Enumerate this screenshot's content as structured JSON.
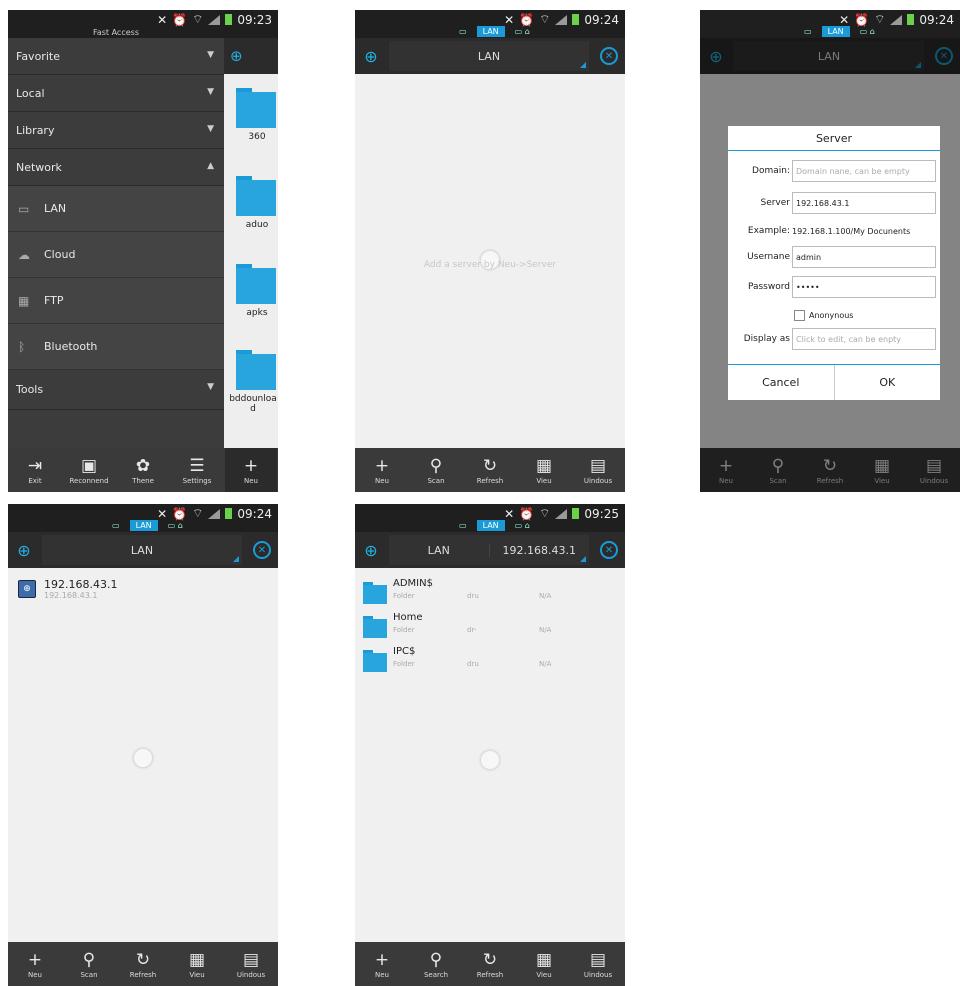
{
  "status": {
    "times": [
      "09:23",
      "09:24",
      "09:24",
      "09:24",
      "09:25"
    ]
  },
  "quick_tabs": {
    "lan": "LAN"
  },
  "drawer": {
    "fast_access": "Fast Access",
    "favorite": "Favorite",
    "local": "Local",
    "library": "Library",
    "network": "Network",
    "lan": "LAN",
    "cloud": "Cloud",
    "ftp": "FTP",
    "bluetooth": "Bluetooth",
    "tools": "Tools"
  },
  "behind_folders": [
    "360",
    "aduo",
    "apks",
    "bddounloa d"
  ],
  "bottom_bar_drawer": [
    {
      "icon": "exit-icon",
      "label": "Exit"
    },
    {
      "icon": "recommend-icon",
      "label": "Reconnend"
    },
    {
      "icon": "theme-icon",
      "label": "Thene"
    },
    {
      "icon": "settings-icon",
      "label": "Settings"
    },
    {
      "icon": "new-icon",
      "label": "Neu"
    }
  ],
  "bottom_bar": [
    {
      "icon": "new-icon",
      "label": "Neu"
    },
    {
      "icon": "scan-icon",
      "label": "Scan"
    },
    {
      "icon": "refresh-icon",
      "label": "Refresh"
    },
    {
      "icon": "view-icon",
      "label": "Vieu"
    },
    {
      "icon": "windows-icon",
      "label": "Uindous"
    }
  ],
  "bottom_bar_search": [
    {
      "icon": "new-icon",
      "label": "Neu"
    },
    {
      "icon": "search-icon",
      "label": "Search"
    },
    {
      "icon": "refresh-icon",
      "label": "Refresh"
    },
    {
      "icon": "view-icon",
      "label": "Vieu"
    },
    {
      "icon": "windows-icon",
      "label": "Uindous"
    }
  ],
  "path": {
    "lan": "LAN",
    "server": "192.168.43.1"
  },
  "empty_hint": "Add a server by Neu->Server",
  "dialog": {
    "title": "Server",
    "domain_label": "Domain:",
    "domain_placeholder": "Domain nane, can be empty",
    "server_label": "Server",
    "server_value": "192.168.43.1",
    "example_label": "Example:",
    "example_value": "192.168.1.100/My Docunents",
    "username_label": "Usernane",
    "username_value": "admin",
    "password_label": "Password",
    "password_value": "•••••",
    "anonymous_label": "Anonynous",
    "display_label": "Display as",
    "display_placeholder": "Click to edit, can be enpty",
    "cancel": "Cancel",
    "ok": "OK"
  },
  "server_entry": {
    "title": "192.168.43.1",
    "subtitle": "192.168.43.1"
  },
  "folders": [
    {
      "name": "ADMIN$",
      "type": "Folder",
      "perm": "dru",
      "size": "N/A"
    },
    {
      "name": "Home",
      "type": "Folder",
      "perm": "dr-",
      "size": "N/A"
    },
    {
      "name": "IPC$",
      "type": "Folder",
      "perm": "dru",
      "size": "N/A"
    }
  ],
  "colors": {
    "accent": "#1a9bd7",
    "toolbar": "#2b2b2b",
    "bottombar": "#3a3a3a"
  }
}
